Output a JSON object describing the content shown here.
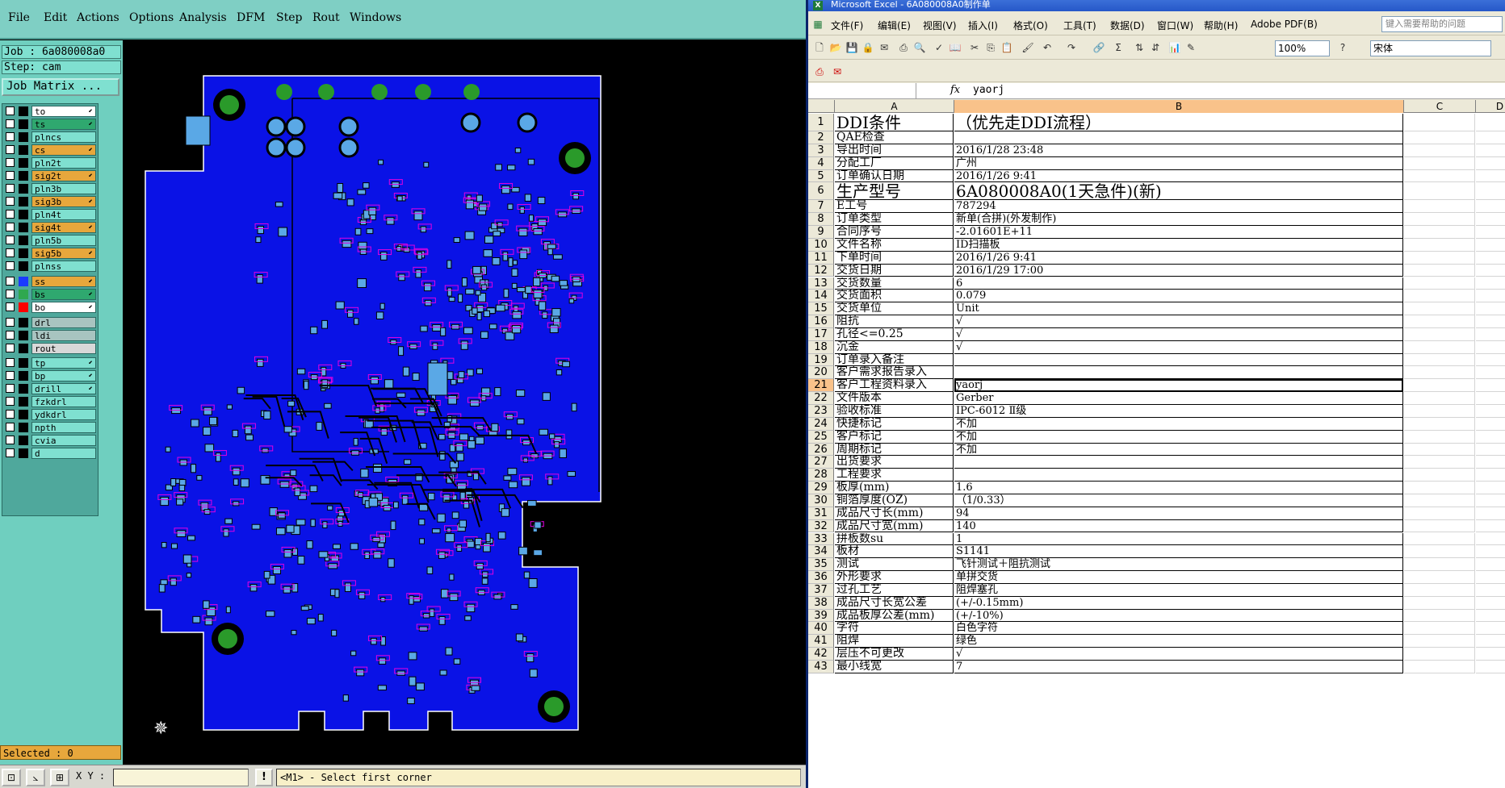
{
  "cam": {
    "menu": [
      "File",
      "Edit",
      "Actions",
      "Options",
      "Analysis",
      "DFM",
      "Step",
      "Rout",
      "Windows"
    ],
    "job_label": "Job : 6a080008a0",
    "step_label": "Step: cam",
    "job_matrix_btn": "Job Matrix ...",
    "layers": [
      {
        "name": "to",
        "color": "#000000",
        "field": "#ffffff",
        "arrow": true
      },
      {
        "name": "ts",
        "color": "#000000",
        "field": "#2fa86f",
        "arrow": true
      },
      {
        "name": "plncs",
        "color": "#000000",
        "field": "#7fe0d0",
        "arrow": false
      },
      {
        "name": "cs",
        "color": "#000000",
        "field": "#e7a73c",
        "arrow": true
      },
      {
        "name": "pln2t",
        "color": "#000000",
        "field": "#7fe0d0",
        "arrow": false
      },
      {
        "name": "sig2t",
        "color": "#000000",
        "field": "#e7a73c",
        "arrow": true
      },
      {
        "name": "pln3b",
        "color": "#000000",
        "field": "#7fe0d0",
        "arrow": false
      },
      {
        "name": "sig3b",
        "color": "#000000",
        "field": "#e7a73c",
        "arrow": true
      },
      {
        "name": "pln4t",
        "color": "#000000",
        "field": "#7fe0d0",
        "arrow": false
      },
      {
        "name": "sig4t",
        "color": "#000000",
        "field": "#e7a73c",
        "arrow": true
      },
      {
        "name": "pln5b",
        "color": "#000000",
        "field": "#7fe0d0",
        "arrow": false
      },
      {
        "name": "sig5b",
        "color": "#000000",
        "field": "#e7a73c",
        "arrow": true
      },
      {
        "name": "plnss",
        "color": "#000000",
        "field": "#7fe0d0",
        "arrow": false
      },
      {
        "name": "ss",
        "color": "#1a3aff",
        "field": "#e7a73c",
        "arrow": true
      },
      {
        "name": "bs",
        "color": "#2fa84f",
        "field": "#2fa86f",
        "arrow": true
      },
      {
        "name": "bo",
        "color": "#ff0000",
        "field": "#ffffff",
        "arrow": true
      },
      {
        "name": "drl",
        "color": "#000000",
        "field": "#a8c4c0",
        "arrow": false
      },
      {
        "name": "ldi",
        "color": "#000000",
        "field": "#a8c4c0",
        "arrow": false
      },
      {
        "name": "rout",
        "color": "#000000",
        "field": "#d8d8d8",
        "arrow": false
      },
      {
        "name": "tp",
        "color": "#000000",
        "field": "#7fe0d0",
        "arrow": true
      },
      {
        "name": "bp",
        "color": "#000000",
        "field": "#7fe0d0",
        "arrow": true
      },
      {
        "name": "drill",
        "color": "#000000",
        "field": "#7fe0d0",
        "arrow": true
      },
      {
        "name": "fzkdrl",
        "color": "#000000",
        "field": "#7fe0d0",
        "arrow": false
      },
      {
        "name": "ydkdrl",
        "color": "#000000",
        "field": "#7fe0d0",
        "arrow": false
      },
      {
        "name": "npth",
        "color": "#000000",
        "field": "#7fe0d0",
        "arrow": false
      },
      {
        "name": "cvia",
        "color": "#000000",
        "field": "#7fe0d0",
        "arrow": false
      },
      {
        "name": "d",
        "color": "#000000",
        "field": "#7fe0d0",
        "arrow": false
      }
    ],
    "selected": "Selected : 0",
    "xy_label": "X Y :",
    "prompt": "<M1> - Select first corner",
    "board_color": "#0a12e6",
    "pad_color": "#5aa8e6",
    "silk_color": "#e000e0",
    "mount_hole_color": "#2a9a2a"
  },
  "excel": {
    "title": "Microsoft Excel - 6A080008A0制作单",
    "menu": [
      "文件(F)",
      "编辑(E)",
      "视图(V)",
      "插入(I)",
      "格式(O)",
      "工具(T)",
      "数据(D)",
      "窗口(W)",
      "帮助(H)",
      "Adobe PDF(B)"
    ],
    "help_placeholder": "键入需要帮助的问题",
    "zoom": "100%",
    "font": "宋体",
    "formula_value": "yaorj",
    "columns": [
      "A",
      "B",
      "C",
      "D"
    ],
    "rows": [
      {
        "n": "1",
        "a": "DDI条件",
        "b": "（优先走DDI流程）",
        "big": true
      },
      {
        "n": "2",
        "a": "QAE检查",
        "b": ""
      },
      {
        "n": "3",
        "a": "导出时间",
        "b": "2016/1/28 23:48"
      },
      {
        "n": "4",
        "a": "分配工厂",
        "b": "广州"
      },
      {
        "n": "5",
        "a": "订单确认日期",
        "b": "2016/1/26 9:41"
      },
      {
        "n": "6",
        "a": "生产型号",
        "b": "6A080008A0(1天急件)(新)",
        "big": true
      },
      {
        "n": "7",
        "a": "E工号",
        "b": "787294"
      },
      {
        "n": "8",
        "a": "订单类型",
        "b": "新单(合拼)(外发制作)"
      },
      {
        "n": "9",
        "a": "合同序号",
        "b": "-2.01601E+11"
      },
      {
        "n": "10",
        "a": "文件名称",
        "b": "ID扫描板"
      },
      {
        "n": "11",
        "a": "下单时间",
        "b": "2016/1/26 9:41"
      },
      {
        "n": "12",
        "a": "交货日期",
        "b": "2016/1/29 17:00"
      },
      {
        "n": "13",
        "a": "交货数量",
        "b": "6"
      },
      {
        "n": "14",
        "a": "交货面积",
        "b": "0.079"
      },
      {
        "n": "15",
        "a": "交货单位",
        "b": "Unit"
      },
      {
        "n": "16",
        "a": "阻抗",
        "b": "√"
      },
      {
        "n": "17",
        "a": "孔径<=0.25",
        "b": "√"
      },
      {
        "n": "18",
        "a": "沉金",
        "b": "√"
      },
      {
        "n": "19",
        "a": "订单录入备注",
        "b": ""
      },
      {
        "n": "20",
        "a": "客户需求报告录入",
        "b": ""
      },
      {
        "n": "21",
        "a": "客户工程资料录入",
        "b": "yaorj",
        "selected": true
      },
      {
        "n": "22",
        "a": "文件版本",
        "b": "Gerber"
      },
      {
        "n": "23",
        "a": "验收标准",
        "b": "IPC-6012 Ⅱ级"
      },
      {
        "n": "24",
        "a": "快捷标记",
        "b": "不加"
      },
      {
        "n": "25",
        "a": "客户标记",
        "b": "不加"
      },
      {
        "n": "26",
        "a": "周期标记",
        "b": "不加"
      },
      {
        "n": "27",
        "a": "出货要求",
        "b": ""
      },
      {
        "n": "28",
        "a": "工程要求",
        "b": ""
      },
      {
        "n": "29",
        "a": "板厚(mm)",
        "b": "1.6"
      },
      {
        "n": "30",
        "a": "铜箔厚度(OZ)",
        "b": "（1/0.33）"
      },
      {
        "n": "31",
        "a": "成品尺寸长(mm)",
        "b": "94"
      },
      {
        "n": "32",
        "a": "成品尺寸宽(mm)",
        "b": "140"
      },
      {
        "n": "33",
        "a": "拼板数su",
        "b": "1"
      },
      {
        "n": "34",
        "a": "板材",
        "b": "S1141"
      },
      {
        "n": "35",
        "a": "测试",
        "b": "飞针测试＋阻抗测试"
      },
      {
        "n": "36",
        "a": "外形要求",
        "b": "单拼交货"
      },
      {
        "n": "37",
        "a": "过孔工艺",
        "b": "阻焊塞孔"
      },
      {
        "n": "38",
        "a": "成品尺寸长宽公差",
        "b": "(+/-0.15mm)"
      },
      {
        "n": "39",
        "a": "成品板厚公差(mm)",
        "b": "(+/-10%)"
      },
      {
        "n": "40",
        "a": "字符",
        "b": "白色字符"
      },
      {
        "n": "41",
        "a": "阻焊",
        "b": "绿色"
      },
      {
        "n": "42",
        "a": "层压不可更改",
        "b": "√"
      },
      {
        "n": "43",
        "a": "最小线宽",
        "b": "7"
      }
    ]
  }
}
